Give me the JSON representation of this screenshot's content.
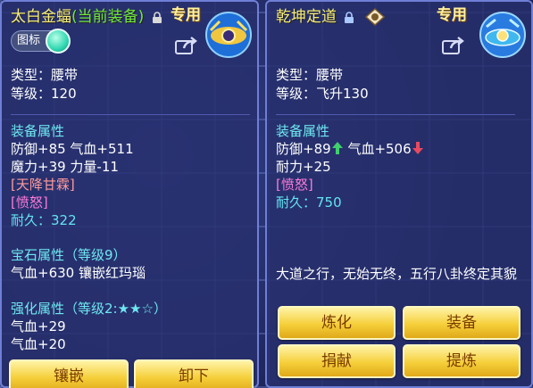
{
  "left": {
    "title": "太白金蝠",
    "title_sub": "(当前装备)",
    "special": "专用",
    "toggle_label": "图标",
    "type_line": "类型：腰带",
    "level_line": "等级：120",
    "attr_head": "装备属性",
    "attr1": "防御+85 气血+511",
    "attr2": "魔力+39 力量-11",
    "effect1": "[天降甘霖]",
    "effect2": "[愤怒]",
    "durability": "耐久：322",
    "gem_head": "宝石属性（等级9）",
    "gem_line": "气血+630 镶嵌红玛瑙",
    "enh_head": "强化属性（等级2:★★☆）",
    "enh1": "气血+29",
    "enh2": "气血+20",
    "buttons": [
      "镶嵌",
      "卸下"
    ]
  },
  "right": {
    "title": "乾坤定道",
    "special": "专用",
    "type_line": "类型：腰带",
    "level_line": "等级：飞升130",
    "attr_head": "装备属性",
    "attr1a": "防御+89",
    "attr1b": "气血+506",
    "attr2": "耐力+25",
    "effect1": "[愤怒]",
    "durability": "耐久：750",
    "description": "大道之行，无始无终，五行八卦终定其貌",
    "buttons": [
      "炼化",
      "装备",
      "捐献",
      "提炼"
    ]
  },
  "colors": {
    "accent_gold": "#f5cf3a",
    "title_yellow": "#f7ee7a",
    "equipped_green": "#6fe83a",
    "section_cyan": "#6ee8f0",
    "effect_pink": "#ff7ad9",
    "up_arrow": "#3fd16a",
    "down_arrow": "#e84a5f"
  },
  "icons": [
    "lock-icon",
    "eight-trigrams-badge-icon",
    "share-icon",
    "belt-item-icon",
    "green-up-arrow-icon",
    "red-down-arrow-icon"
  ]
}
